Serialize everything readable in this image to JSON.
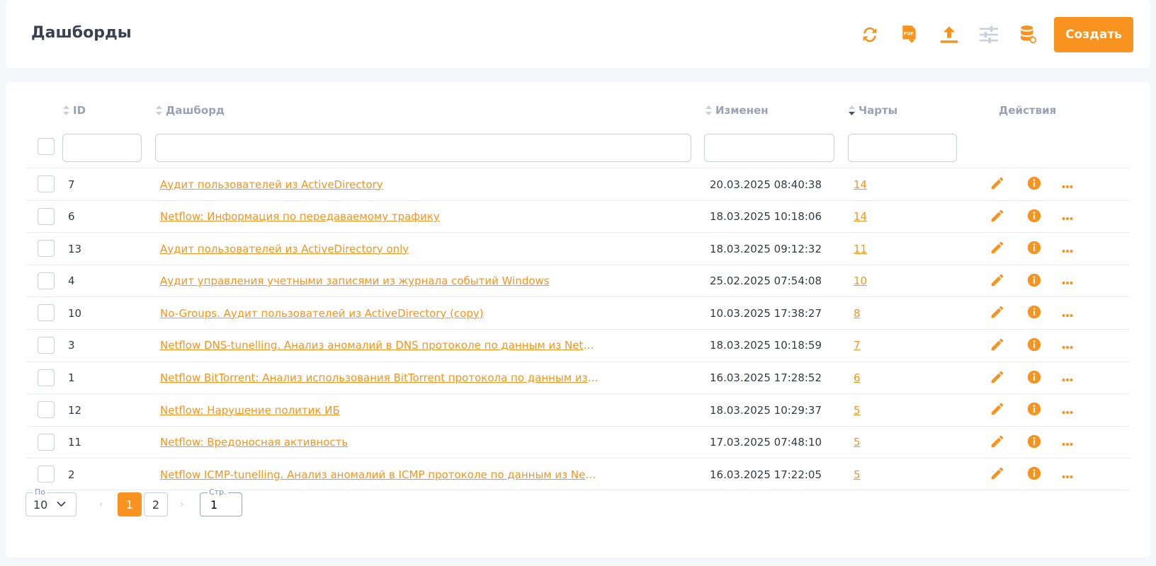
{
  "header": {
    "title": "Дашборды",
    "create_label": "Создать"
  },
  "toolbar_icons": [
    "refresh-icon",
    "pdf-download-icon",
    "upload-icon",
    "sliders-icon",
    "database-icon"
  ],
  "colors": {
    "accent": "#f7931e",
    "header_text": "#99a1b3",
    "disabled_icon": "#c9d0dc"
  },
  "table": {
    "columns": {
      "id": "ID",
      "name": "Дашборд",
      "modified": "Изменен",
      "charts": "Чарты",
      "actions": "Действия"
    },
    "rows": [
      {
        "id": "7",
        "name": "Аудит пользователей из ActiveDirectory",
        "modified": "20.03.2025 08:40:38",
        "charts": "14"
      },
      {
        "id": "6",
        "name": "Netflow: Информация по передаваемому трафику",
        "modified": "18.03.2025 10:18:06",
        "charts": "14"
      },
      {
        "id": "13",
        "name": "Аудит пользователей из ActiveDirectory only",
        "modified": "18.03.2025 09:12:32",
        "charts": "11"
      },
      {
        "id": "4",
        "name": "Аудит управления учетными записями из журнала событий Windows",
        "modified": "25.02.2025 07:54:08",
        "charts": "10"
      },
      {
        "id": "10",
        "name": "No-Groups. Аудит пользователей из ActiveDirectory (copy)",
        "modified": "10.03.2025 17:38:27",
        "charts": "8"
      },
      {
        "id": "3",
        "name": "Netflow DNS-tunelling. Анализ аномалий в DNS протоколе по данным из Netflow.",
        "modified": "18.03.2025 10:18:59",
        "charts": "7"
      },
      {
        "id": "1",
        "name": "Netflow BitTorrent: Анализ использования BitTorrent протокола по данным из Ne...",
        "modified": "16.03.2025 17:28:52",
        "charts": "6"
      },
      {
        "id": "12",
        "name": "Netflow: Нарушение политик ИБ",
        "modified": "18.03.2025 10:29:37",
        "charts": "5"
      },
      {
        "id": "11",
        "name": "Netflow: Вредоносная активность",
        "modified": "17.03.2025 07:48:10",
        "charts": "5"
      },
      {
        "id": "2",
        "name": "Netflow ICMP-tunelling. Анализ аномалий в ICMP протоколе по данным из Netflo...",
        "modified": "16.03.2025 17:22:05",
        "charts": "5"
      }
    ]
  },
  "pagination": {
    "per_page_label": "По",
    "per_page_value": "10",
    "prev": "‹",
    "next": "›",
    "pages": [
      "1",
      "2"
    ],
    "current_page": "1",
    "goto_label": "Стр.",
    "goto_value": "1"
  }
}
